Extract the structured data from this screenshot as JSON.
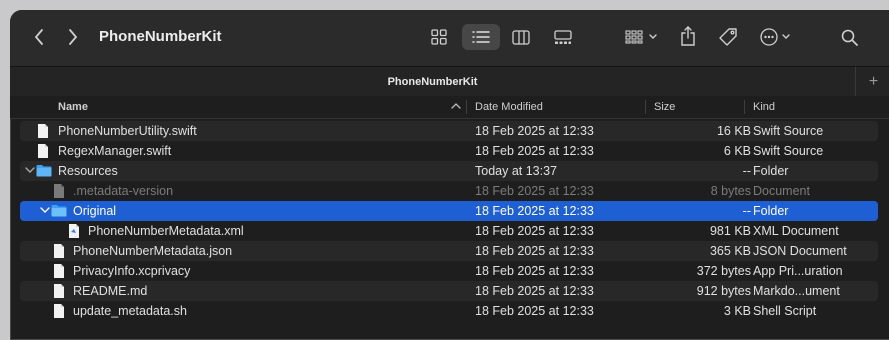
{
  "window": {
    "title": "PhoneNumberKit",
    "tab_title": "PhoneNumberKit",
    "tab_add": "+"
  },
  "toolbar": {
    "back_icon": "chevron-left-icon",
    "forward_icon": "chevron-right-icon",
    "view_modes": [
      "icon-view-icon",
      "list-view-icon",
      "column-view-icon",
      "gallery-view-icon"
    ],
    "active_view": "list-view-icon",
    "group_icon": "group-by-icon",
    "share_icon": "share-icon",
    "tag_icon": "tag-icon",
    "more_icon": "more-actions-icon",
    "search_icon": "search-icon"
  },
  "columns": {
    "name": "Name",
    "date": "Date Modified",
    "size": "Size",
    "kind": "Kind"
  },
  "colors": {
    "selection": "#1f5fd4",
    "folder": "#3fa2f0",
    "window_bg": "#1e1e1e"
  },
  "rows": [
    {
      "name": "PhoneNumberUtility.swift",
      "date": "18 Feb 2025 at 12:33",
      "size": "16 KB",
      "kind": "Swift Source",
      "icon": "file-icon"
    },
    {
      "name": "RegexManager.swift",
      "date": "18 Feb 2025 at 12:33",
      "size": "6 KB",
      "kind": "Swift Source",
      "icon": "file-icon"
    },
    {
      "name": "Resources",
      "date": "Today at 13:37",
      "size": "--",
      "kind": "Folder",
      "icon": "folder-icon",
      "expanded": true
    },
    {
      "name": ".metadata-version",
      "date": "18 Feb 2025 at 12:33",
      "size": "8 bytes",
      "kind": "Document",
      "icon": "file-icon",
      "hidden_file": true
    },
    {
      "name": "Original",
      "date": "18 Feb 2025 at 12:33",
      "size": "--",
      "kind": "Folder",
      "icon": "folder-icon",
      "expanded": true,
      "selected": true
    },
    {
      "name": "PhoneNumberMetadata.xml",
      "date": "18 Feb 2025 at 12:33",
      "size": "981 KB",
      "kind": "XML Document",
      "icon": "xml-file-icon"
    },
    {
      "name": "PhoneNumberMetadata.json",
      "date": "18 Feb 2025 at 12:33",
      "size": "365 KB",
      "kind": "JSON Document",
      "icon": "file-icon"
    },
    {
      "name": "PrivacyInfo.xcprivacy",
      "date": "18 Feb 2025 at 12:33",
      "size": "372 bytes",
      "kind": "App Pri...uration",
      "icon": "file-icon"
    },
    {
      "name": "README.md",
      "date": "18 Feb 2025 at 12:33",
      "size": "912 bytes",
      "kind": "Markdo...ument",
      "icon": "file-icon"
    },
    {
      "name": "update_metadata.sh",
      "date": "18 Feb 2025 at 12:33",
      "size": "3 KB",
      "kind": "Shell Script",
      "icon": "file-icon"
    }
  ]
}
